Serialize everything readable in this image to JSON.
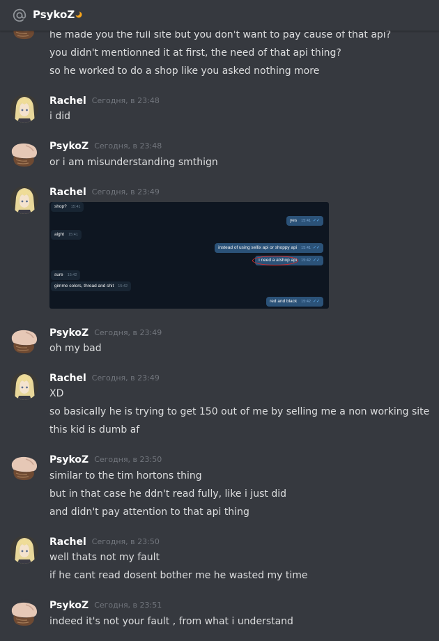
{
  "channel": {
    "name": "PsykoZ",
    "status_icon": "moon-icon"
  },
  "colors": {
    "background": "#36393f",
    "username": "#ffffff",
    "text": "#dcddde",
    "timestamp": "#72767d"
  },
  "messages": [
    {
      "author": "",
      "time": "",
      "lines": [
        "he made you the full site but you don't want to pay cause of that api?",
        "you didn't mentionned it at first, the need of that api thing?",
        "so he worked to do a shop like you asked nothing more"
      ]
    },
    {
      "author": "Rachel",
      "time": "Сегодня, в 23:48",
      "lines": [
        "i did"
      ]
    },
    {
      "author": "PsykoZ",
      "time": "Сегодня, в 23:48",
      "lines": [
        "or i am misunderstanding smthign"
      ]
    },
    {
      "author": "Rachel",
      "time": "Сегодня, в 23:49",
      "lines": []
    },
    {
      "author": "PsykoZ",
      "time": "Сегодня, в 23:49",
      "lines": [
        "oh my bad"
      ]
    },
    {
      "author": "Rachel",
      "time": "Сегодня, в 23:49",
      "lines": [
        "XD",
        "so basically he is trying to get 150 out of me by selling me a non working site",
        "this kid is dumb af"
      ]
    },
    {
      "author": "PsykoZ",
      "time": "Сегодня, в 23:50",
      "lines": [
        "similar to the tim hortons thing",
        "but in that case he ddn't read fully, like i just did",
        "and didn't pay attention to that api thing"
      ]
    },
    {
      "author": "Rachel",
      "time": "Сегодня, в 23:50",
      "lines": [
        "well thats not my fault",
        "if he cant read dosent bother me he wasted my time"
      ]
    },
    {
      "author": "PsykoZ",
      "time": "Сегодня, в 23:51",
      "lines": [
        "indeed it's not your fault , from what i understand"
      ]
    }
  ],
  "attachment": {
    "bubbles": [
      {
        "text": "shop?",
        "time": "15:41",
        "dir": "in"
      },
      {
        "text": "yes",
        "time": "15:41",
        "dir": "out"
      },
      {
        "text": "aight",
        "time": "15:41",
        "dir": "in"
      },
      {
        "text": "instead of using sellix api or shoppy api",
        "time": "15:41",
        "dir": "out"
      },
      {
        "text": "i need a atshop api",
        "time": "15:42",
        "dir": "out"
      },
      {
        "text": "sure",
        "time": "15:42",
        "dir": "in"
      },
      {
        "text": "gimme colors, thread and shit",
        "time": "15:42",
        "dir": "in"
      },
      {
        "text": "red and black",
        "time": "15:42",
        "dir": "out"
      }
    ]
  }
}
